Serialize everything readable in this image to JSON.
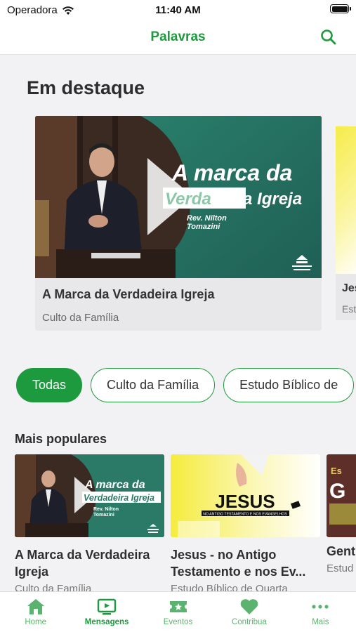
{
  "status_bar": {
    "carrier": "Operadora",
    "time": "11:40 AM"
  },
  "nav": {
    "title": "Palavras"
  },
  "featured": {
    "heading": "Em destaque",
    "cards": [
      {
        "thumb_line1": "A marca da",
        "thumb_line2a": "Verda",
        "thumb_line2b": "deira Igreja",
        "thumb_speaker1": "Rev. Nilton",
        "thumb_speaker2": "Tomazini",
        "title": "A Marca da Verdadeira Igreja",
        "subtitle": "Culto da Família"
      },
      {
        "title": "Jes",
        "subtitle": "Est"
      }
    ]
  },
  "filters": {
    "chips": [
      {
        "label": "Todas",
        "active": true
      },
      {
        "label": "Culto da Família",
        "active": false
      },
      {
        "label": "Estudo Bíblico de",
        "active": false
      }
    ]
  },
  "popular": {
    "heading": "Mais populares",
    "cards": [
      {
        "thumb_line1": "A marca da",
        "thumb_line2": "Verdadeira Igreja",
        "thumb_speaker1": "Rev. Nilton",
        "thumb_speaker2": "Tomazini",
        "title": "A Marca da Verdadeira Igreja",
        "subtitle": "Culto da Família"
      },
      {
        "thumb_word": "JESUS",
        "thumb_caption": "NO ANTIGO TESTAMENTO E NOS EVANGELHOS",
        "title": "Jesus - no Antigo Testamento e nos Ev...",
        "subtitle": "Estudo Bíblico de Quarta"
      },
      {
        "thumb_letter_top": "Es",
        "thumb_letter_mid": "G",
        "title": "Gent",
        "subtitle": "Estud"
      }
    ]
  },
  "tabs": [
    {
      "label": "Home",
      "icon": "home-icon"
    },
    {
      "label": "Mensagens",
      "icon": "tv-icon",
      "active": true
    },
    {
      "label": "Eventos",
      "icon": "ticket-icon"
    },
    {
      "label": "Contribua",
      "icon": "heart-icon"
    },
    {
      "label": "Mais",
      "icon": "more-icon"
    }
  ],
  "colors": {
    "accent": "#1e9a3e",
    "tab_inactive": "#5ab36e",
    "thumb_teal": "#2f7d6a"
  }
}
